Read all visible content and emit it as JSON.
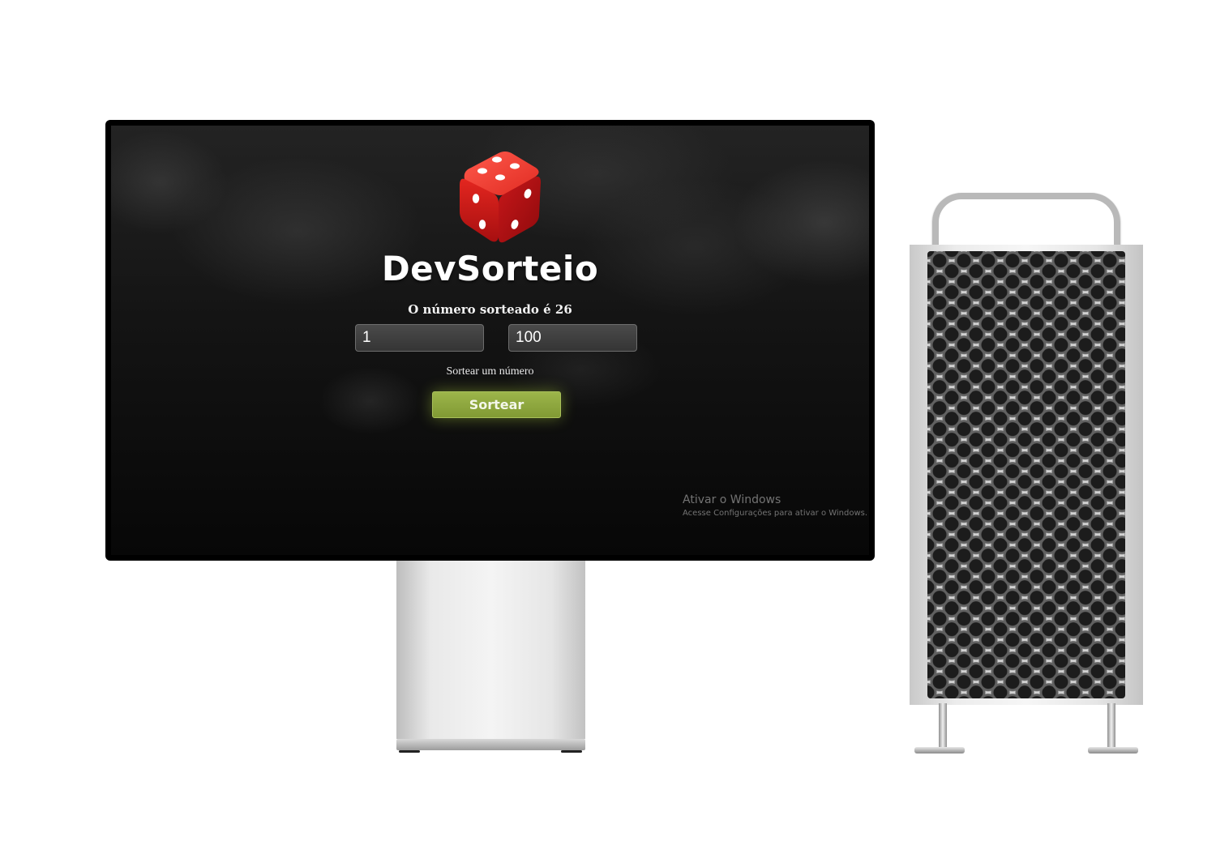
{
  "app": {
    "title": "DevSorteio",
    "result_text": "O número sorteado é 26",
    "min_value": "1",
    "max_value": "100",
    "instruction": "Sortear um número",
    "button_label": "Sortear"
  },
  "windows_watermark": {
    "title": "Ativar o Windows",
    "subtitle": "Acesse Configurações para ativar o Windows."
  },
  "colors": {
    "button": "#8ea73e",
    "dice": "#d8231f",
    "screen_bg": "#0f0f0f"
  },
  "icons": {
    "logo": "red-dice-icon"
  }
}
